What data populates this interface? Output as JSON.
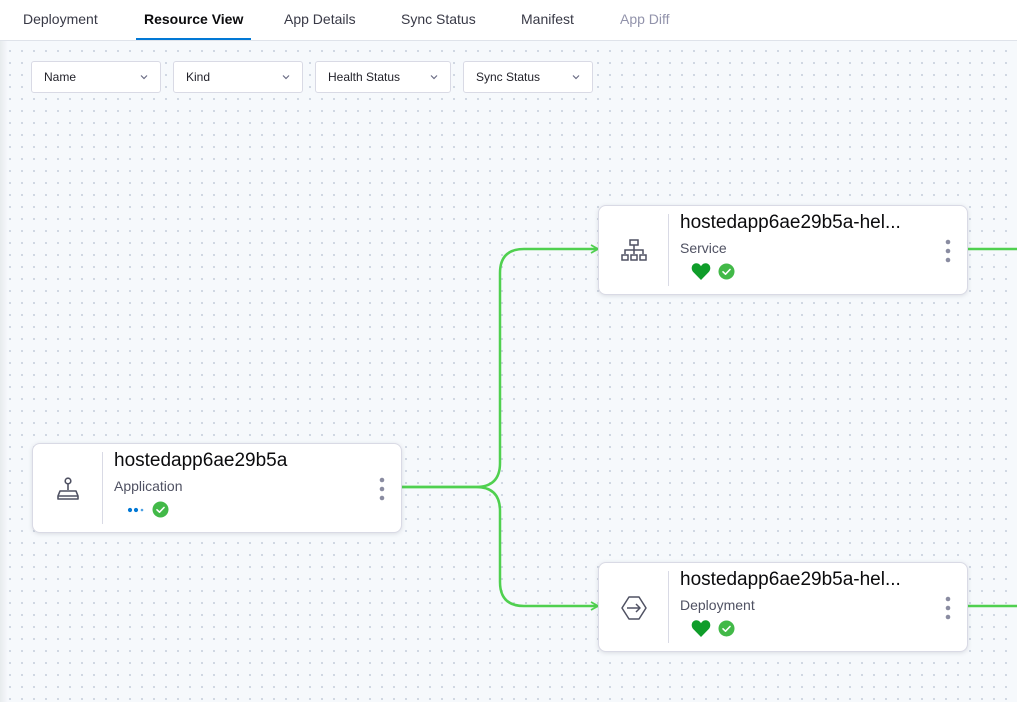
{
  "tabs": [
    {
      "label": "Deployment",
      "state": "normal"
    },
    {
      "label": "Resource View",
      "state": "active"
    },
    {
      "label": "App Details",
      "state": "normal"
    },
    {
      "label": "Sync Status",
      "state": "normal"
    },
    {
      "label": "Manifest",
      "state": "normal"
    },
    {
      "label": "App Diff",
      "state": "disabled"
    }
  ],
  "filters": [
    {
      "label": "Name",
      "icon": "chevron-down-icon"
    },
    {
      "label": "Kind",
      "icon": "chevron-down-icon"
    },
    {
      "label": "Health Status",
      "icon": "chevron-down-icon"
    },
    {
      "label": "Sync Status",
      "icon": "chevron-down-icon"
    }
  ],
  "nodes": {
    "application": {
      "name": "hostedapp6ae29b5a",
      "kind": "Application",
      "icon": "joystick-icon",
      "health": "progressing-dots-icon",
      "sync": "synced-check-icon"
    },
    "service": {
      "name": "hostedapp6ae29b5a-hel...",
      "kind": "Service",
      "icon": "network-tree-icon",
      "health": "healthy-heart-icon",
      "sync": "synced-check-icon"
    },
    "deployment": {
      "name": "hostedapp6ae29b5a-hel...",
      "kind": "Deployment",
      "icon": "deployment-arrow-icon",
      "health": "healthy-heart-icon",
      "sync": "synced-check-icon"
    }
  },
  "colors": {
    "accent": "#0278d5",
    "edge": "#4fd04f",
    "healthy": "#0f9d2a",
    "synced": "#42b948"
  }
}
